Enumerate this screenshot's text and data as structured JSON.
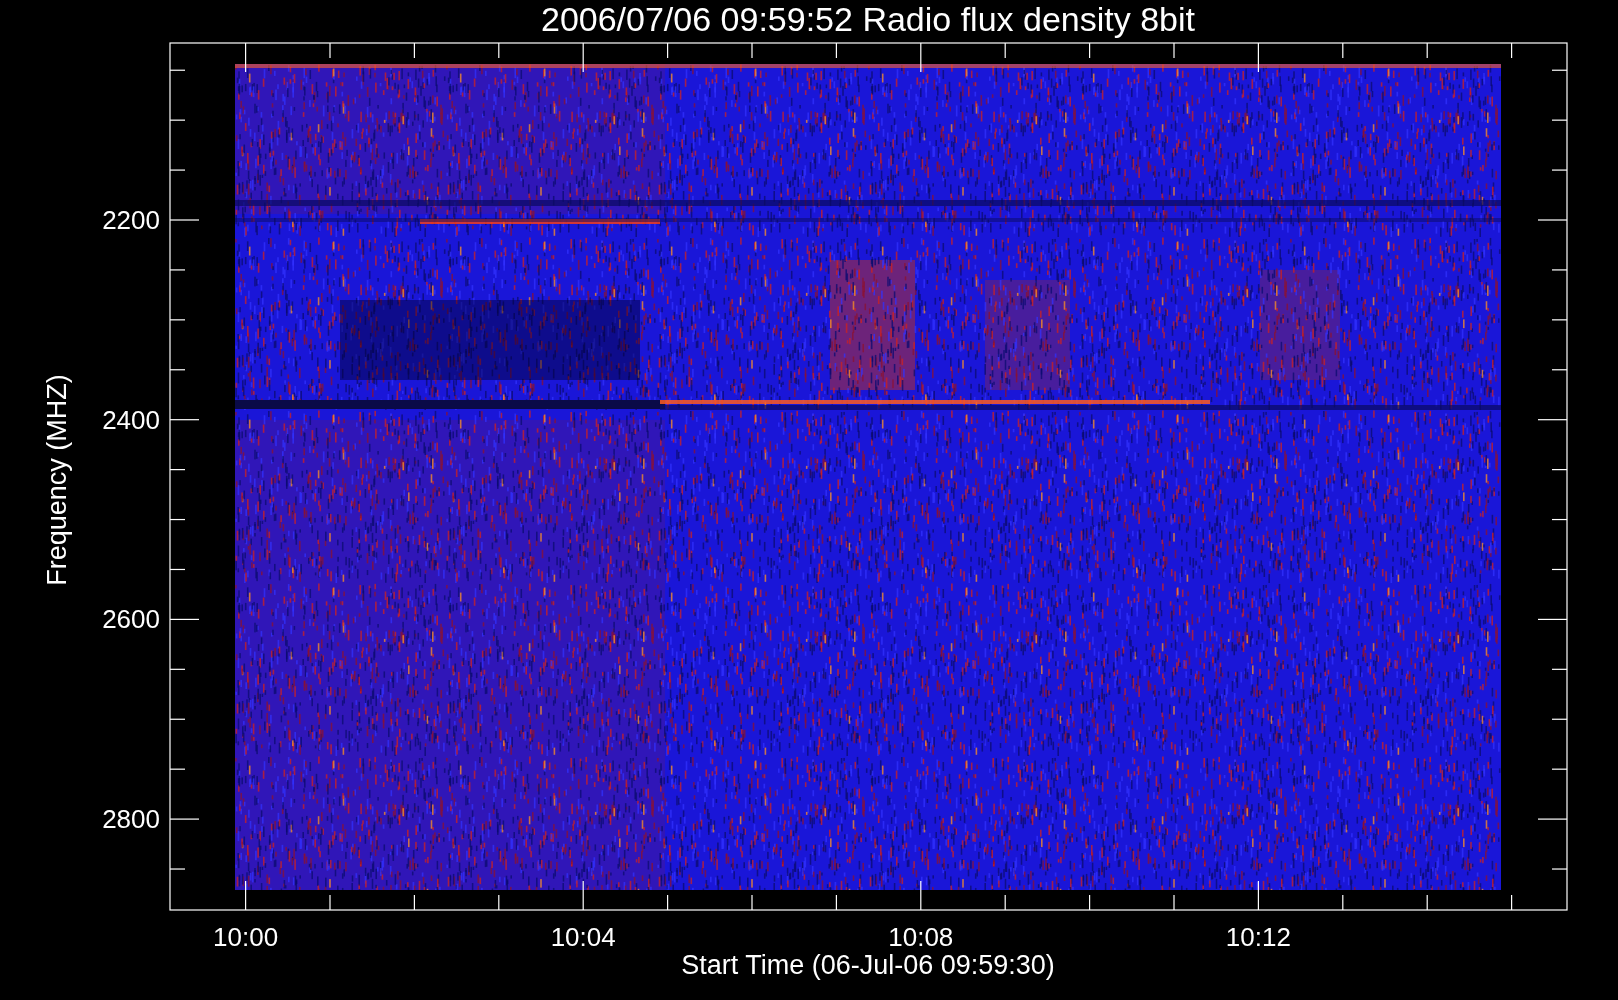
{
  "title": "2006/07/06 09:59:52 Radio flux density 8bit",
  "y_axis": {
    "label": "Frequency (MHZ)",
    "ticks": [
      "2200",
      "2400",
      "2600",
      "2800"
    ]
  },
  "x_axis": {
    "label": "Start Time (06-Jul-06 09:59:30)",
    "ticks": [
      "10:00",
      "10:04",
      "10:08",
      "10:12"
    ]
  }
}
